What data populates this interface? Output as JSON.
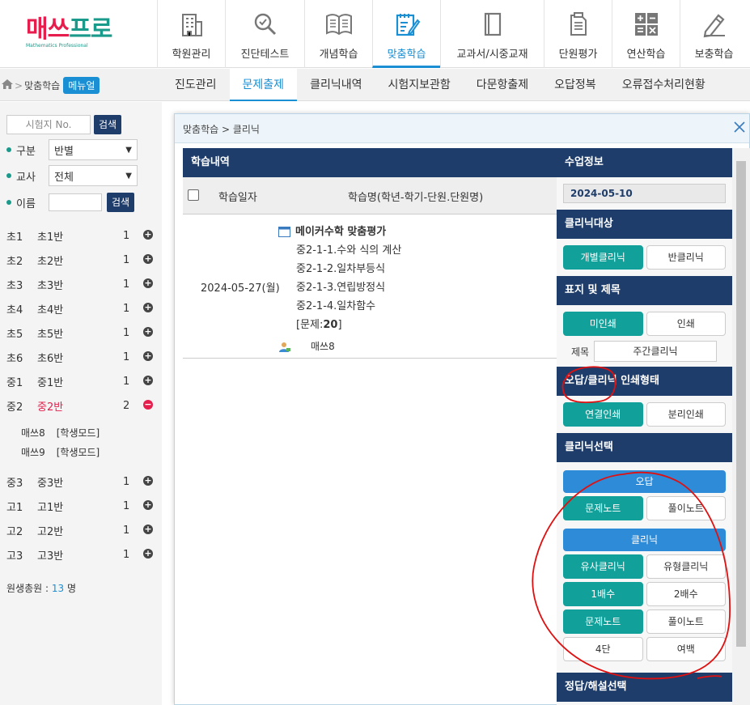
{
  "logo": {
    "text_a": "매쓰",
    "text_b": "프로",
    "sub": "Mathematics Professional"
  },
  "nav": [
    {
      "label": "학원관리",
      "icon": "building-icon",
      "width": 84
    },
    {
      "label": "진단테스트",
      "icon": "magnifier-icon",
      "width": 98
    },
    {
      "label": "개념학습",
      "icon": "book-icon",
      "width": 84
    },
    {
      "label": "맞춤학습",
      "icon": "note-pencil-icon",
      "width": 84,
      "active": true
    },
    {
      "label": "교과서/시중교재",
      "icon": "textbook-icon",
      "width": 128
    },
    {
      "label": "단원평가",
      "icon": "document-icon",
      "width": 84
    },
    {
      "label": "연산학습",
      "icon": "calculator-icon",
      "width": 84
    },
    {
      "label": "보충학습",
      "icon": "pencil-icon",
      "width": 84
    }
  ],
  "breadcrumb": {
    "text": "맞춤학습",
    "menu": "메뉴얼"
  },
  "subtabs": [
    "진도관리",
    "문제출제",
    "클리닉내역",
    "시험지보관함",
    "다문항출제",
    "오답정복",
    "오류접수처리현황"
  ],
  "active_subtab": 1,
  "left": {
    "exam_placeholder": "시험지 No.",
    "search": "검색",
    "filters": [
      {
        "label": "구분",
        "value": "반별"
      },
      {
        "label": "교사",
        "value": "전체"
      }
    ],
    "name_label": "이름",
    "name_search": "검색",
    "classes": [
      {
        "a": "초1",
        "b": "초1반",
        "n": "1",
        "sign": "+"
      },
      {
        "a": "초2",
        "b": "초2반",
        "n": "1",
        "sign": "+"
      },
      {
        "a": "초3",
        "b": "초3반",
        "n": "1",
        "sign": "+"
      },
      {
        "a": "초4",
        "b": "초4반",
        "n": "1",
        "sign": "+"
      },
      {
        "a": "초5",
        "b": "초5반",
        "n": "1",
        "sign": "+"
      },
      {
        "a": "초6",
        "b": "초6반",
        "n": "1",
        "sign": "+"
      },
      {
        "a": "중1",
        "b": "중1반",
        "n": "1",
        "sign": "+"
      },
      {
        "a": "중2",
        "b": "중2반",
        "n": "2",
        "sign": "−",
        "open": true,
        "students": [
          {
            "name": "매쓰8",
            "mode": "[학생모드]"
          },
          {
            "name": "매쓰9",
            "mode": "[학생모드]"
          }
        ]
      },
      {
        "a": "중3",
        "b": "중3반",
        "n": "1",
        "sign": "+"
      },
      {
        "a": "고1",
        "b": "고1반",
        "n": "1",
        "sign": "+"
      },
      {
        "a": "고2",
        "b": "고2반",
        "n": "1",
        "sign": "+"
      },
      {
        "a": "고3",
        "b": "고3반",
        "n": "1",
        "sign": "+"
      }
    ],
    "total_label": "원생총원 : ",
    "total_count": "13",
    "total_unit": " 명"
  },
  "modal": {
    "title": "맞춤학습 > 클리닉",
    "history": {
      "header": "학습내역",
      "col_date": "학습일자",
      "col_name": "학습명(학년-학기-단원.단원명)",
      "row": {
        "date": "2024-05-27(월)",
        "title": "메이커수학 맞춤평가",
        "lines": [
          "중2-1-1.수와 식의 계산",
          "중2-1-2.일차부등식",
          "중2-1-3.연립방정식",
          "중2-1-4.일차함수"
        ],
        "count_prefix": "[문제:",
        "count": "20",
        "count_suffix": "]",
        "user": "매쓰8"
      }
    },
    "info": {
      "class_info": "수업정보",
      "date": "2024-05-10",
      "target": {
        "header": "클리닉대상",
        "a": "개별클리닉",
        "b": "반클리닉"
      },
      "mark": {
        "header": "표지 및 제목",
        "a": "미인쇄",
        "b": "인쇄",
        "title_label": "제목",
        "title_value": "주간클리닉"
      },
      "print_type": {
        "header": "오답/클리닉 인쇄형태",
        "a": "연결인쇄",
        "b": "분리인쇄"
      },
      "clinic_select": {
        "header": "클리닉선택",
        "wrong": "오답",
        "wrong_a": "문제노트",
        "wrong_b": "풀이노트",
        "clinic": "클리닉",
        "c1a": "유사클리닉",
        "c1b": "유형클리닉",
        "c2a": "1배수",
        "c2b": "2배수",
        "c3a": "문제노트",
        "c3b": "풀이노트",
        "c4a": "4단",
        "c4b": "여백"
      },
      "answer": {
        "header": "정답/해설선택"
      }
    }
  }
}
